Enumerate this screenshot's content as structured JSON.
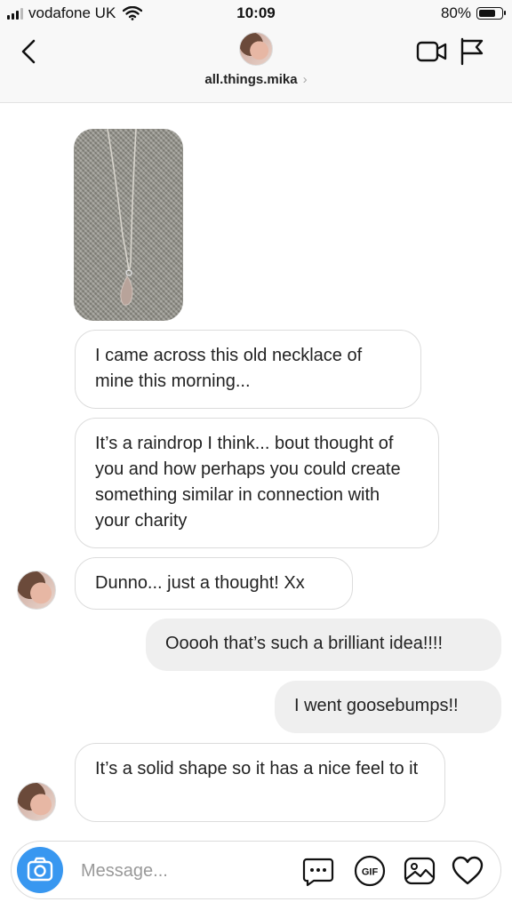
{
  "status": {
    "carrier": "vodafone UK",
    "time": "10:09",
    "battery": "80%",
    "battery_level": 0.8
  },
  "header": {
    "username": "all.things.mika",
    "chevron": "›",
    "icons": [
      "back-arrow-icon",
      "video-camera-icon",
      "flag-icon"
    ]
  },
  "messages": [
    {
      "type": "photo",
      "direction": "in",
      "icon": "necklace-photo"
    },
    {
      "type": "text",
      "direction": "in",
      "text": "I came across this old necklace of mine this morning..."
    },
    {
      "type": "text",
      "direction": "in",
      "text": "It’s a raindrop I think... bout thought of you and how perhaps you could create something similar in connection with your charity"
    },
    {
      "type": "text",
      "direction": "in",
      "text": "Dunno... just a thought! Xx"
    },
    {
      "type": "text",
      "direction": "out",
      "text": "Ooooh that’s such a brilliant idea!!!!"
    },
    {
      "type": "text",
      "direction": "out",
      "text": "I went goosebumps!!"
    },
    {
      "type": "text",
      "direction": "in",
      "text": "It’s a solid shape so it has a nice feel to it"
    }
  ],
  "composer": {
    "placeholder": "Message...",
    "gif_label": "GIF",
    "icons": [
      "camera-icon",
      "more-icon",
      "gif-icon",
      "gallery-icon",
      "heart-icon"
    ],
    "accent": "#3897f0"
  }
}
